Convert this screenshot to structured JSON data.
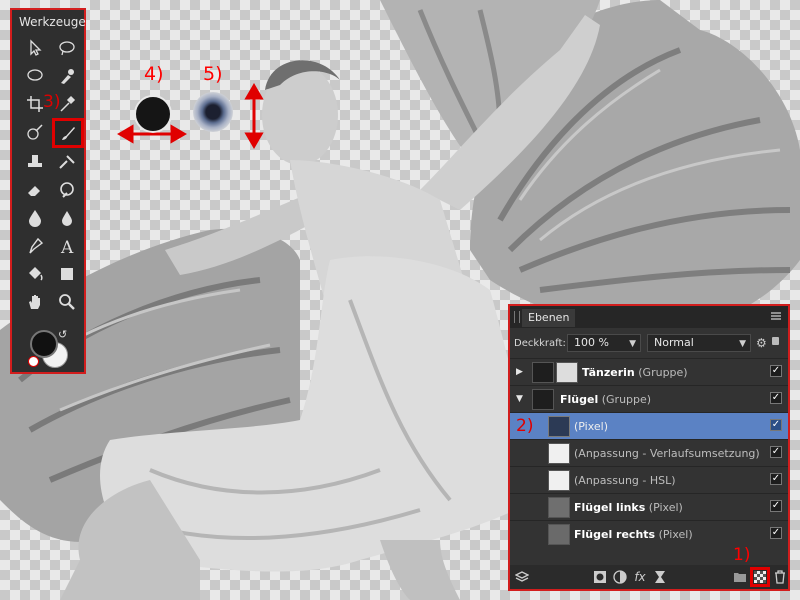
{
  "tools_panel": {
    "title": "Werkzeuge",
    "icons": [
      "move-icon",
      "select-icon",
      "lasso-icon",
      "smudge-icon",
      "crop-icon",
      "eyedropper-icon",
      "color-picker-icon",
      "paint-brush-icon",
      "stamp-icon",
      "pixel-brush-icon",
      "eraser-icon",
      "dodge-icon",
      "blur-icon",
      "drop-icon",
      "pen-icon",
      "text-icon",
      "fill-icon",
      "shape-icon",
      "hand-icon",
      "zoom-icon"
    ]
  },
  "annotations": {
    "n1": "1)",
    "n2": "2)",
    "n3": "3)",
    "n4": "4)",
    "n5": "5)",
    "color": "#e00000"
  },
  "layers_panel": {
    "tab": "Ebenen",
    "opacity_label": "Deckkraft:",
    "opacity_value": "100 %",
    "blend_mode": "Normal",
    "rows": [
      {
        "name": "Tänzerin",
        "type": "(Gruppe)",
        "bold": true
      },
      {
        "name": "Flügel",
        "type": "(Gruppe)",
        "bold": true
      },
      {
        "name": "",
        "type": "(Pixel)",
        "bold": false
      },
      {
        "name": "",
        "type": "(Anpassung - Verlaufsumsetzung)",
        "bold": false
      },
      {
        "name": "",
        "type": "(Anpassung - HSL)",
        "bold": false
      },
      {
        "name": "Flügel links",
        "type": "(Pixel)",
        "bold": true
      },
      {
        "name": "Flügel rechts",
        "type": "(Pixel)",
        "bold": true
      }
    ],
    "checkmark": "✓"
  },
  "colors": {
    "selected_row": "#5b82c4",
    "panel_bg": "#333333",
    "highlight": "#e00000"
  }
}
